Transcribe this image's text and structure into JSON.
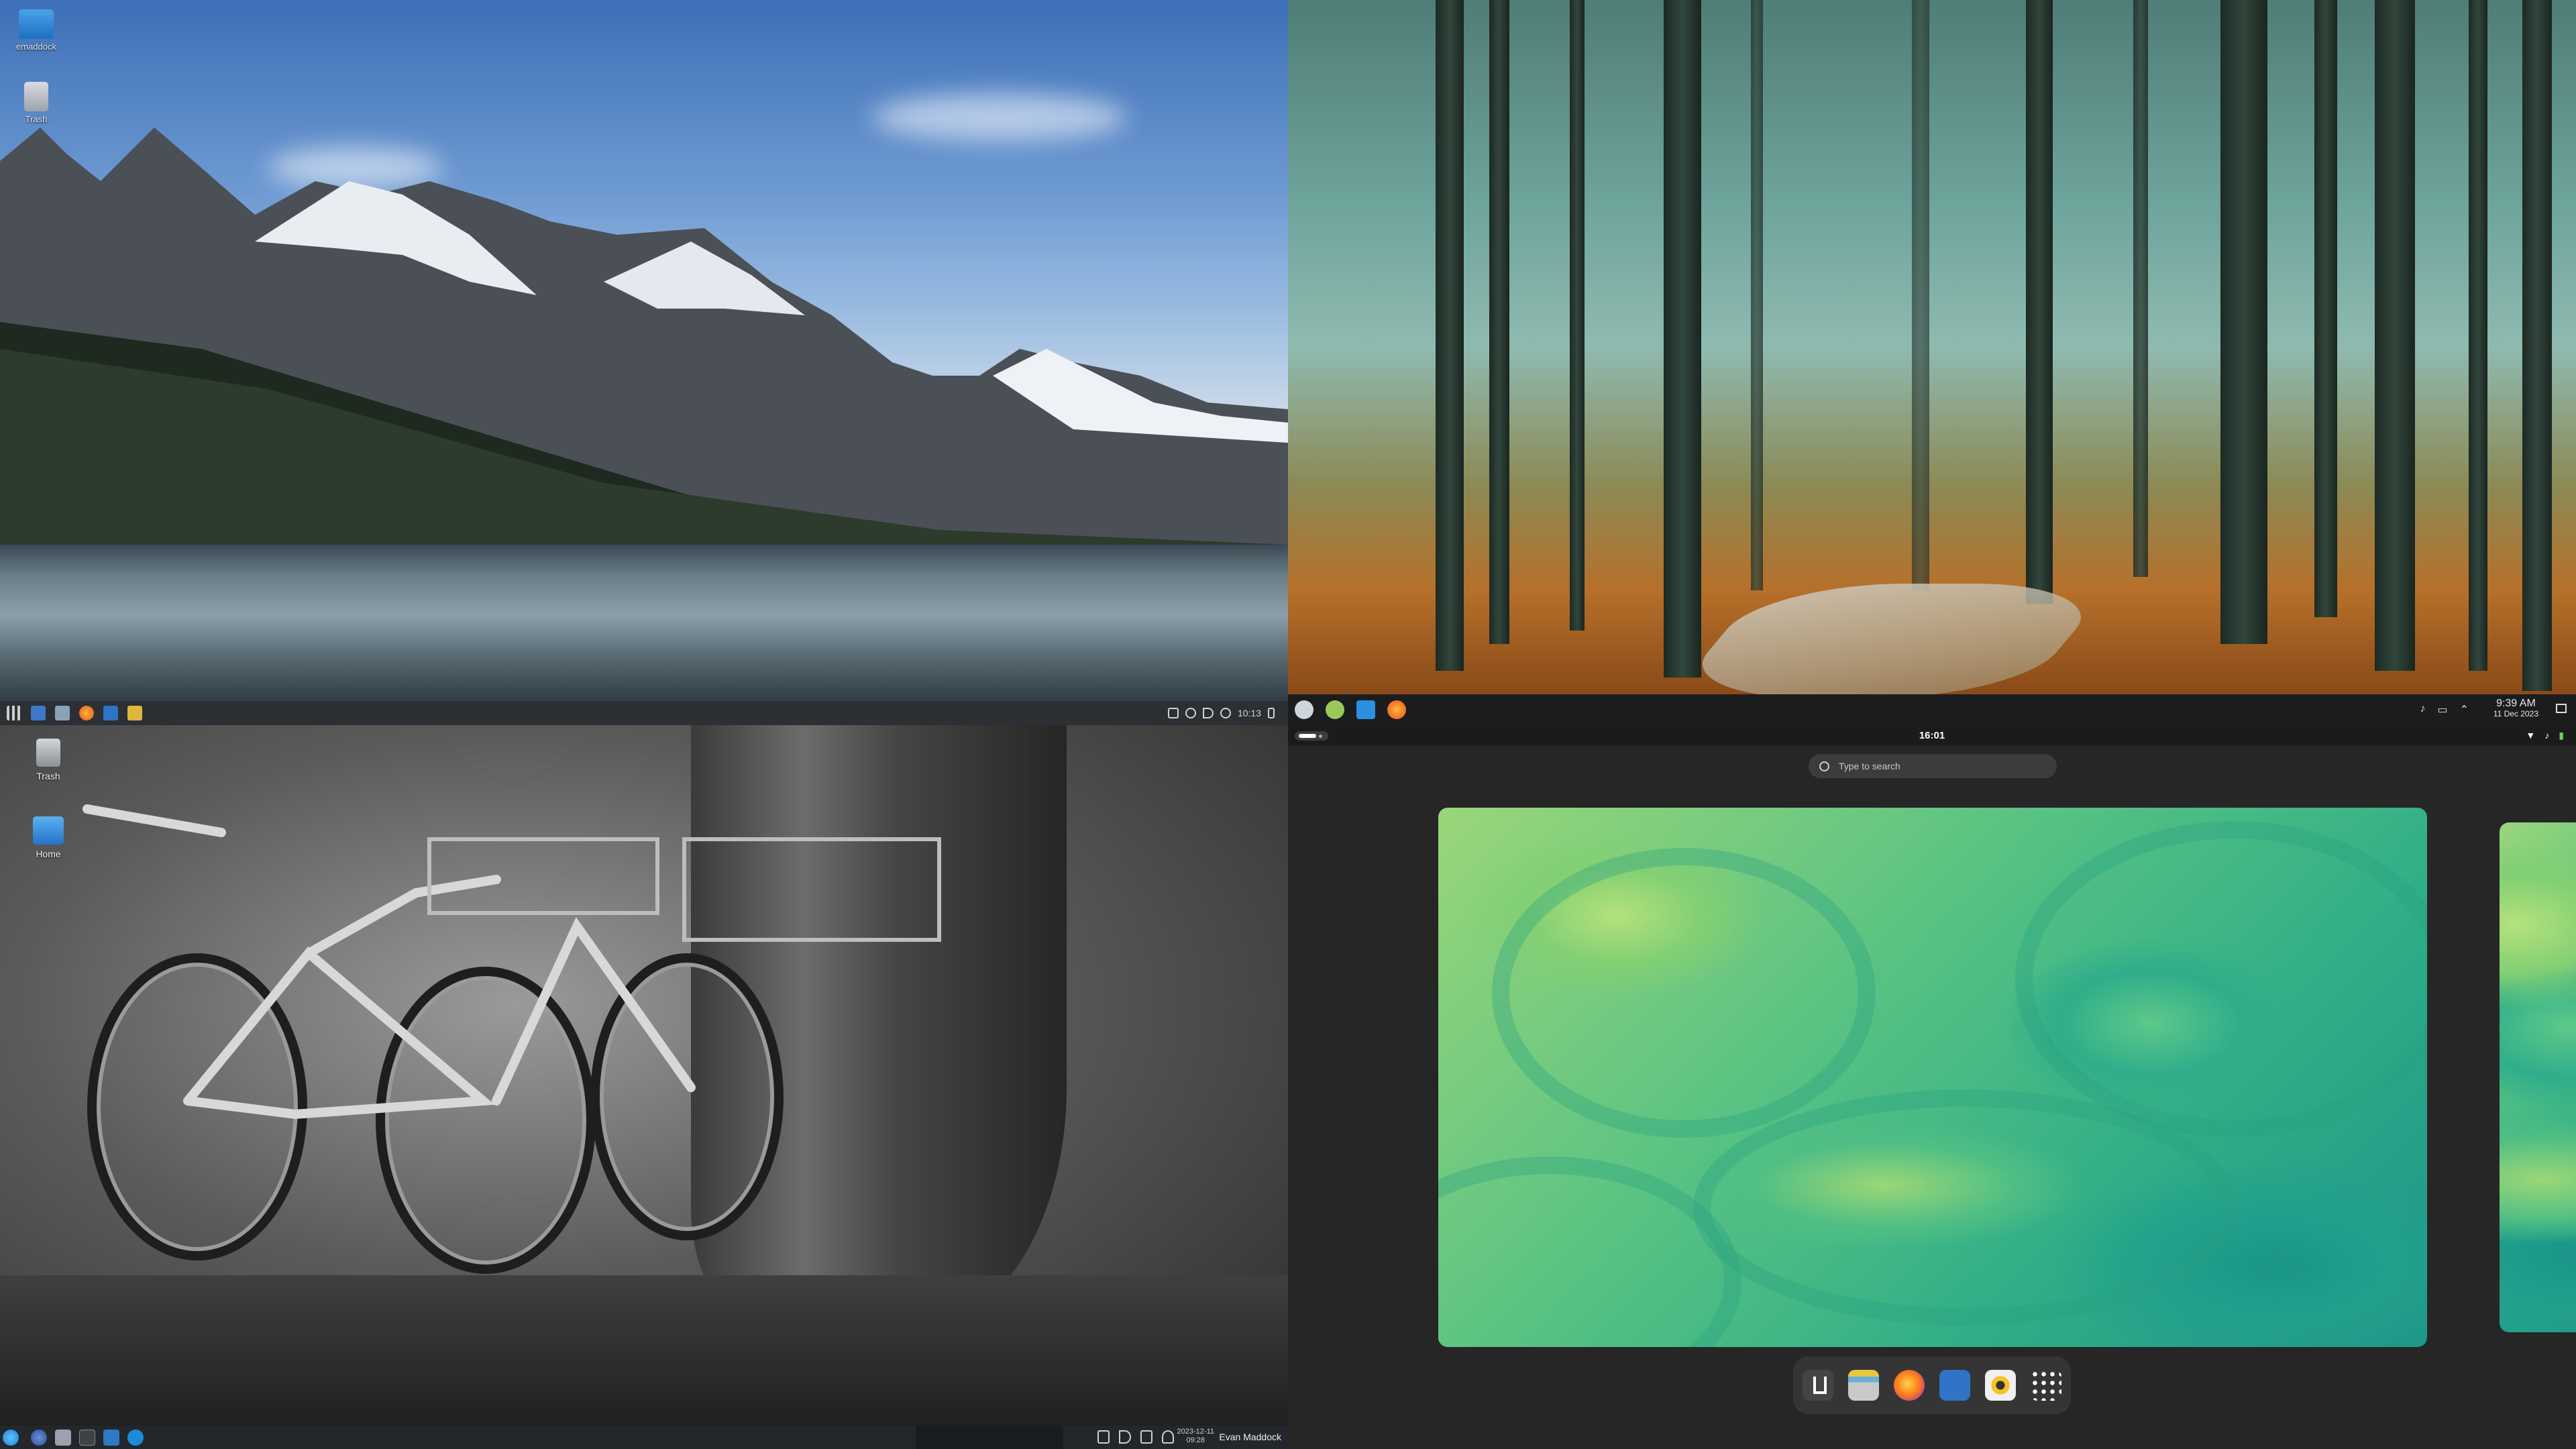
{
  "top_left": {
    "desktop_icons": [
      {
        "label": "emaddock",
        "icon": "home-folder-icon"
      },
      {
        "label": "Trash",
        "icon": "trash-icon"
      }
    ],
    "panel": {
      "clock": "10:13"
    }
  },
  "top_right": {
    "panel": {
      "time": "9:39 AM",
      "date": "11 Dec 2023"
    }
  },
  "bottom_left": {
    "desktop_icons": [
      {
        "label": "Trash",
        "icon": "trash-icon"
      },
      {
        "label": "Home",
        "icon": "home-folder-icon"
      }
    ],
    "panel": {
      "date": "2023-12-11",
      "time": "09:28",
      "user": "Evan Maddock"
    }
  },
  "bottom_right": {
    "clock": "16:01",
    "search": {
      "placeholder": "Type to search"
    },
    "dock_apps": [
      {
        "name": "download-icon",
        "color": "#4a4a4a"
      },
      {
        "name": "files-icon",
        "color": "#c7c7c7"
      },
      {
        "name": "firefox-icon",
        "color": "#ff7a1a"
      },
      {
        "name": "video-player-icon",
        "color": "#2f74c7"
      },
      {
        "name": "rhythmbox-icon",
        "color": "#f5c422"
      },
      {
        "name": "app-grid-icon",
        "color": "#ffffff"
      }
    ]
  }
}
